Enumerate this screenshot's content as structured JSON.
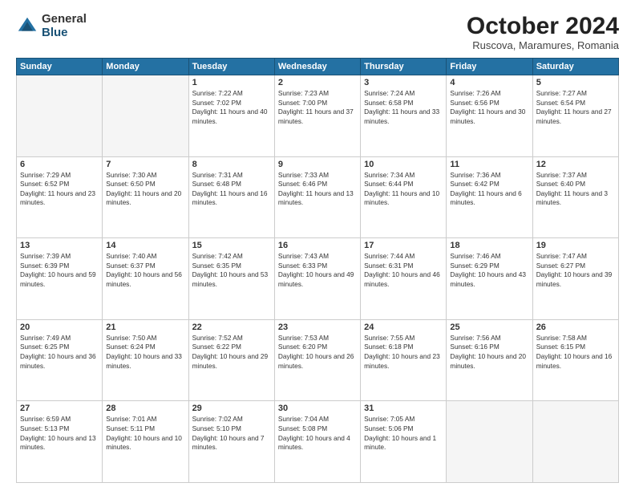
{
  "header": {
    "logo": {
      "general": "General",
      "blue": "Blue"
    },
    "title": "October 2024",
    "subtitle": "Ruscova, Maramures, Romania"
  },
  "weekdays": [
    "Sunday",
    "Monday",
    "Tuesday",
    "Wednesday",
    "Thursday",
    "Friday",
    "Saturday"
  ],
  "weeks": [
    [
      {
        "day": "",
        "empty": true
      },
      {
        "day": "",
        "empty": true
      },
      {
        "day": "1",
        "sunrise": "Sunrise: 7:22 AM",
        "sunset": "Sunset: 7:02 PM",
        "daylight": "Daylight: 11 hours and 40 minutes."
      },
      {
        "day": "2",
        "sunrise": "Sunrise: 7:23 AM",
        "sunset": "Sunset: 7:00 PM",
        "daylight": "Daylight: 11 hours and 37 minutes."
      },
      {
        "day": "3",
        "sunrise": "Sunrise: 7:24 AM",
        "sunset": "Sunset: 6:58 PM",
        "daylight": "Daylight: 11 hours and 33 minutes."
      },
      {
        "day": "4",
        "sunrise": "Sunrise: 7:26 AM",
        "sunset": "Sunset: 6:56 PM",
        "daylight": "Daylight: 11 hours and 30 minutes."
      },
      {
        "day": "5",
        "sunrise": "Sunrise: 7:27 AM",
        "sunset": "Sunset: 6:54 PM",
        "daylight": "Daylight: 11 hours and 27 minutes."
      }
    ],
    [
      {
        "day": "6",
        "sunrise": "Sunrise: 7:29 AM",
        "sunset": "Sunset: 6:52 PM",
        "daylight": "Daylight: 11 hours and 23 minutes."
      },
      {
        "day": "7",
        "sunrise": "Sunrise: 7:30 AM",
        "sunset": "Sunset: 6:50 PM",
        "daylight": "Daylight: 11 hours and 20 minutes."
      },
      {
        "day": "8",
        "sunrise": "Sunrise: 7:31 AM",
        "sunset": "Sunset: 6:48 PM",
        "daylight": "Daylight: 11 hours and 16 minutes."
      },
      {
        "day": "9",
        "sunrise": "Sunrise: 7:33 AM",
        "sunset": "Sunset: 6:46 PM",
        "daylight": "Daylight: 11 hours and 13 minutes."
      },
      {
        "day": "10",
        "sunrise": "Sunrise: 7:34 AM",
        "sunset": "Sunset: 6:44 PM",
        "daylight": "Daylight: 11 hours and 10 minutes."
      },
      {
        "day": "11",
        "sunrise": "Sunrise: 7:36 AM",
        "sunset": "Sunset: 6:42 PM",
        "daylight": "Daylight: 11 hours and 6 minutes."
      },
      {
        "day": "12",
        "sunrise": "Sunrise: 7:37 AM",
        "sunset": "Sunset: 6:40 PM",
        "daylight": "Daylight: 11 hours and 3 minutes."
      }
    ],
    [
      {
        "day": "13",
        "sunrise": "Sunrise: 7:39 AM",
        "sunset": "Sunset: 6:39 PM",
        "daylight": "Daylight: 10 hours and 59 minutes."
      },
      {
        "day": "14",
        "sunrise": "Sunrise: 7:40 AM",
        "sunset": "Sunset: 6:37 PM",
        "daylight": "Daylight: 10 hours and 56 minutes."
      },
      {
        "day": "15",
        "sunrise": "Sunrise: 7:42 AM",
        "sunset": "Sunset: 6:35 PM",
        "daylight": "Daylight: 10 hours and 53 minutes."
      },
      {
        "day": "16",
        "sunrise": "Sunrise: 7:43 AM",
        "sunset": "Sunset: 6:33 PM",
        "daylight": "Daylight: 10 hours and 49 minutes."
      },
      {
        "day": "17",
        "sunrise": "Sunrise: 7:44 AM",
        "sunset": "Sunset: 6:31 PM",
        "daylight": "Daylight: 10 hours and 46 minutes."
      },
      {
        "day": "18",
        "sunrise": "Sunrise: 7:46 AM",
        "sunset": "Sunset: 6:29 PM",
        "daylight": "Daylight: 10 hours and 43 minutes."
      },
      {
        "day": "19",
        "sunrise": "Sunrise: 7:47 AM",
        "sunset": "Sunset: 6:27 PM",
        "daylight": "Daylight: 10 hours and 39 minutes."
      }
    ],
    [
      {
        "day": "20",
        "sunrise": "Sunrise: 7:49 AM",
        "sunset": "Sunset: 6:25 PM",
        "daylight": "Daylight: 10 hours and 36 minutes."
      },
      {
        "day": "21",
        "sunrise": "Sunrise: 7:50 AM",
        "sunset": "Sunset: 6:24 PM",
        "daylight": "Daylight: 10 hours and 33 minutes."
      },
      {
        "day": "22",
        "sunrise": "Sunrise: 7:52 AM",
        "sunset": "Sunset: 6:22 PM",
        "daylight": "Daylight: 10 hours and 29 minutes."
      },
      {
        "day": "23",
        "sunrise": "Sunrise: 7:53 AM",
        "sunset": "Sunset: 6:20 PM",
        "daylight": "Daylight: 10 hours and 26 minutes."
      },
      {
        "day": "24",
        "sunrise": "Sunrise: 7:55 AM",
        "sunset": "Sunset: 6:18 PM",
        "daylight": "Daylight: 10 hours and 23 minutes."
      },
      {
        "day": "25",
        "sunrise": "Sunrise: 7:56 AM",
        "sunset": "Sunset: 6:16 PM",
        "daylight": "Daylight: 10 hours and 20 minutes."
      },
      {
        "day": "26",
        "sunrise": "Sunrise: 7:58 AM",
        "sunset": "Sunset: 6:15 PM",
        "daylight": "Daylight: 10 hours and 16 minutes."
      }
    ],
    [
      {
        "day": "27",
        "sunrise": "Sunrise: 6:59 AM",
        "sunset": "Sunset: 5:13 PM",
        "daylight": "Daylight: 10 hours and 13 minutes."
      },
      {
        "day": "28",
        "sunrise": "Sunrise: 7:01 AM",
        "sunset": "Sunset: 5:11 PM",
        "daylight": "Daylight: 10 hours and 10 minutes."
      },
      {
        "day": "29",
        "sunrise": "Sunrise: 7:02 AM",
        "sunset": "Sunset: 5:10 PM",
        "daylight": "Daylight: 10 hours and 7 minutes."
      },
      {
        "day": "30",
        "sunrise": "Sunrise: 7:04 AM",
        "sunset": "Sunset: 5:08 PM",
        "daylight": "Daylight: 10 hours and 4 minutes."
      },
      {
        "day": "31",
        "sunrise": "Sunrise: 7:05 AM",
        "sunset": "Sunset: 5:06 PM",
        "daylight": "Daylight: 10 hours and 1 minute."
      },
      {
        "day": "",
        "empty": true
      },
      {
        "day": "",
        "empty": true
      }
    ]
  ]
}
